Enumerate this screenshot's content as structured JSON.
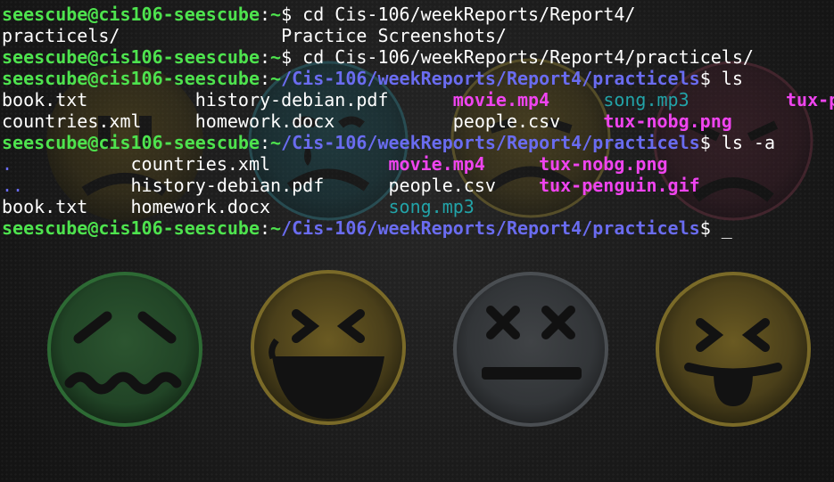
{
  "prompt": {
    "user_host": "seescube@cis106-seescube",
    "colon": ":",
    "home": "~",
    "dollar": "$ "
  },
  "lines": [
    {
      "type": "prompt",
      "path": "",
      "command": "cd Cis-106/weekReports/Report4/"
    },
    {
      "type": "output",
      "items": [
        {
          "text": "practicels/",
          "kind": "file",
          "pad": 26
        },
        {
          "text": "Practice Screenshots/",
          "kind": "file",
          "pad": 0
        }
      ]
    },
    {
      "type": "prompt",
      "path": "",
      "command": "cd Cis-106/weekReports/Report4/practicels/"
    },
    {
      "type": "prompt",
      "path": "/Cis-106/weekReports/Report4/practicels",
      "command": "ls"
    },
    {
      "type": "output",
      "items": [
        {
          "text": "book.txt",
          "kind": "file",
          "pad": 18
        },
        {
          "text": "history-debian.pdf",
          "kind": "file",
          "pad": 24
        },
        {
          "text": "movie.mp4",
          "kind": "media",
          "pad": 14
        },
        {
          "text": "song.mp3",
          "kind": "audio",
          "pad": 17
        },
        {
          "text": "tux-penguin.gif",
          "kind": "media",
          "pad": 0
        }
      ]
    },
    {
      "type": "output",
      "items": [
        {
          "text": "countries.xml",
          "kind": "file",
          "pad": 18
        },
        {
          "text": "homework.docx",
          "kind": "file",
          "pad": 24
        },
        {
          "text": "people.csv",
          "kind": "file",
          "pad": 14
        },
        {
          "text": "tux-nobg.png",
          "kind": "media",
          "pad": 0
        }
      ]
    },
    {
      "type": "prompt",
      "path": "/Cis-106/weekReports/Report4/practicels",
      "command": "ls -a"
    },
    {
      "type": "output",
      "items": [
        {
          "text": ".",
          "kind": "dir",
          "pad": 12
        },
        {
          "text": "countries.xml",
          "kind": "file",
          "pad": 24
        },
        {
          "text": "movie.mp4",
          "kind": "media",
          "pad": 14
        },
        {
          "text": "tux-nobg.png",
          "kind": "media",
          "pad": 0
        }
      ]
    },
    {
      "type": "output",
      "items": [
        {
          "text": "..",
          "kind": "dir",
          "pad": 12
        },
        {
          "text": "history-debian.pdf",
          "kind": "file",
          "pad": 24
        },
        {
          "text": "people.csv",
          "kind": "file",
          "pad": 14
        },
        {
          "text": "tux-penguin.gif",
          "kind": "media",
          "pad": 0
        }
      ]
    },
    {
      "type": "output",
      "items": [
        {
          "text": "book.txt",
          "kind": "file",
          "pad": 12
        },
        {
          "text": "homework.docx",
          "kind": "file",
          "pad": 24
        },
        {
          "text": "song.mp3",
          "kind": "audio",
          "pad": 0
        }
      ]
    },
    {
      "type": "prompt",
      "path": "/Cis-106/weekReports/Report4/practicels",
      "command": "",
      "cursor": "_"
    }
  ],
  "colors": {
    "user_host": "#4ee34e",
    "path": "#6a6cf0",
    "media": "#ef44ef",
    "audio": "#22a3a8",
    "text": "#ffffff",
    "background": "#1c1c1c"
  },
  "wallpaper": {
    "icons": [
      "frowning-face-icon",
      "crying-face-icon",
      "sad-face-icon",
      "angry-face-icon",
      "wavy-mouth-face-icon",
      "laughing-face-icon",
      "dizzy-face-icon",
      "tongue-out-face-icon"
    ]
  }
}
